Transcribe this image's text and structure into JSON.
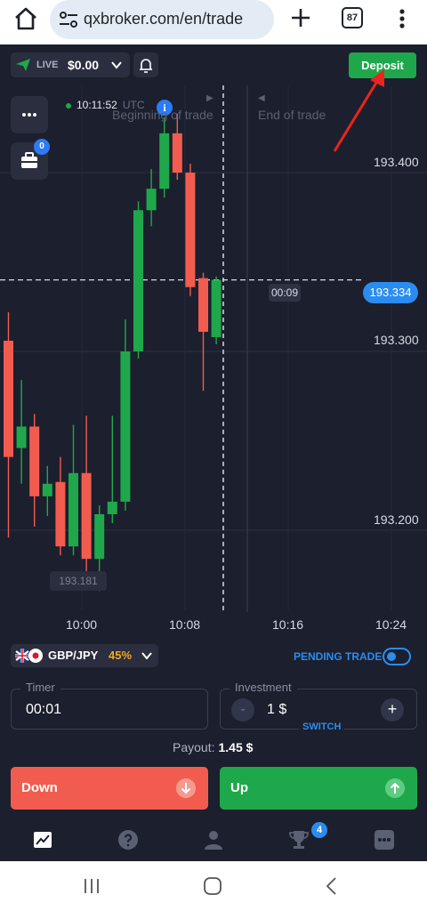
{
  "browser": {
    "url": "qxbroker.com/en/trade",
    "tab_count": "87"
  },
  "top_bar": {
    "account_mode": "LIVE",
    "balance": "$0.00",
    "deposit_label": "Deposit"
  },
  "chart": {
    "time": "10:11:52",
    "timezone": "UTC",
    "info_label": "i",
    "beginning_label": "Beginning of trade",
    "end_label": "End of trade",
    "briefcase_badge": "0",
    "current_price": "193.334",
    "countdown": "00:09",
    "low_price": "193.181",
    "price_levels": [
      "193.400",
      "193.300",
      "193.200"
    ],
    "time_labels": [
      "10:00",
      "10:08",
      "10:16",
      "10:24"
    ]
  },
  "chart_data": {
    "type": "candlestick",
    "y_ticks": [
      193.4,
      193.3,
      193.2
    ],
    "x_ticks": [
      "10:00",
      "10:08",
      "10:16",
      "10:24"
    ],
    "current_price": 193.334,
    "candles": [
      {
        "dir": "down",
        "open": 193.3,
        "close": 193.235,
        "high": 193.316,
        "low": 193.19
      },
      {
        "dir": "up",
        "open": 193.24,
        "close": 193.252,
        "high": 193.278,
        "low": 193.22
      },
      {
        "dir": "down",
        "open": 193.252,
        "close": 193.213,
        "high": 193.259,
        "low": 193.196
      },
      {
        "dir": "up",
        "open": 193.213,
        "close": 193.22,
        "high": 193.23,
        "low": 193.202
      },
      {
        "dir": "down",
        "open": 193.221,
        "close": 193.185,
        "high": 193.235,
        "low": 193.18
      },
      {
        "dir": "up",
        "open": 193.185,
        "close": 193.226,
        "high": 193.253,
        "low": 193.18
      },
      {
        "dir": "down",
        "open": 193.226,
        "close": 193.178,
        "high": 193.258,
        "low": 193.17
      },
      {
        "dir": "up",
        "open": 193.178,
        "close": 193.203,
        "high": 193.208,
        "low": 193.16
      },
      {
        "dir": "up",
        "open": 193.203,
        "close": 193.21,
        "high": 193.258,
        "low": 193.198
      },
      {
        "dir": "up",
        "open": 193.21,
        "close": 193.294,
        "high": 193.312,
        "low": 193.205
      },
      {
        "dir": "up",
        "open": 193.294,
        "close": 193.373,
        "high": 193.378,
        "low": 193.29
      },
      {
        "dir": "up",
        "open": 193.373,
        "close": 193.385,
        "high": 193.396,
        "low": 193.364
      },
      {
        "dir": "up",
        "open": 193.385,
        "close": 193.416,
        "high": 193.425,
        "low": 193.38
      },
      {
        "dir": "down",
        "open": 193.416,
        "close": 193.394,
        "high": 193.427,
        "low": 193.39
      },
      {
        "dir": "down",
        "open": 193.394,
        "close": 193.33,
        "high": 193.399,
        "low": 193.325
      },
      {
        "dir": "down",
        "open": 193.335,
        "close": 193.305,
        "high": 193.338,
        "low": 193.272
      },
      {
        "dir": "up",
        "open": 193.302,
        "close": 193.334,
        "high": 193.336,
        "low": 193.298
      }
    ]
  },
  "pair": {
    "name": "GBP/JPY",
    "payout_pct": "45%",
    "pending_label": "PENDING TRADE"
  },
  "timer": {
    "label": "Timer",
    "value": "00:01"
  },
  "investment": {
    "label": "Investment",
    "value": "1 $",
    "minus": "-",
    "plus": "+",
    "switch_label": "SWITCH"
  },
  "payout": {
    "label": "Payout:",
    "value": "1.45 $"
  },
  "actions": {
    "down_label": "Down",
    "up_label": "Up"
  },
  "bottom_nav": {
    "trophy_badge": "4"
  },
  "colors": {
    "background": "#1c1f2d",
    "up": "#1fa84b",
    "down": "#f25c4f",
    "accent": "#2b8cf0"
  }
}
